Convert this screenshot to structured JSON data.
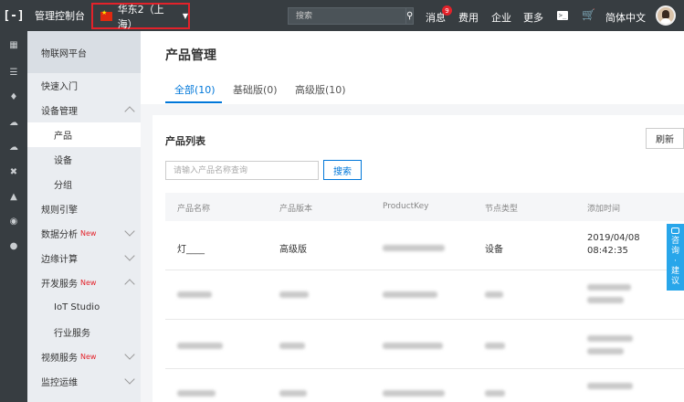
{
  "topbar": {
    "logo": "[-]",
    "console": "管理控制台",
    "region": "华东2（上海）",
    "search_placeholder": "搜索",
    "messages": "消息",
    "message_count": "9",
    "billing": "费用",
    "enterprise": "企业",
    "more": "更多",
    "language": "简体中文"
  },
  "rail_icons": [
    "grid-icon",
    "list-icon",
    "shield-icon",
    "cloud-icon",
    "cloud-gear-icon",
    "shuffle-icon",
    "nodes-icon",
    "globe-icon",
    "circle-icon"
  ],
  "sidebar": {
    "header": "物联网平台",
    "items": [
      {
        "label": "快速入门",
        "level": 1
      },
      {
        "label": "设备管理",
        "level": 1
      },
      {
        "label": "产品",
        "level": 2
      },
      {
        "label": "设备",
        "level": 2
      },
      {
        "label": "分组",
        "level": 2
      },
      {
        "label": "规则引擎",
        "level": 1
      },
      {
        "label": "数据分析",
        "level": 1,
        "tag": "New"
      },
      {
        "label": "边缘计算",
        "level": 1
      },
      {
        "label": "开发服务",
        "level": 1,
        "tag": "New"
      },
      {
        "label": "IoT Studio",
        "level": 2
      },
      {
        "label": "行业服务",
        "level": 2
      },
      {
        "label": "视频服务",
        "level": 1,
        "tag": "New"
      },
      {
        "label": "监控运维",
        "level": 1
      }
    ]
  },
  "main": {
    "title": "产品管理",
    "tabs": [
      "全部(10)",
      "基础版(0)",
      "高级版(10)"
    ],
    "panel_title": "产品列表",
    "refresh": "刷新",
    "search_placeholder": "请输入产品名称查询",
    "search_button": "搜索",
    "columns": [
      "产品名称",
      "产品版本",
      "ProductKey",
      "节点类型",
      "添加时间"
    ],
    "rows": [
      {
        "name": "灯____",
        "version": "高级版",
        "node_type": "设备",
        "date": "2019/04/08",
        "time": "08:42:35"
      }
    ]
  },
  "side_tab": {
    "line1": "咨",
    "line2": "询",
    "line3": "·",
    "line4": "建",
    "line5": "议"
  }
}
